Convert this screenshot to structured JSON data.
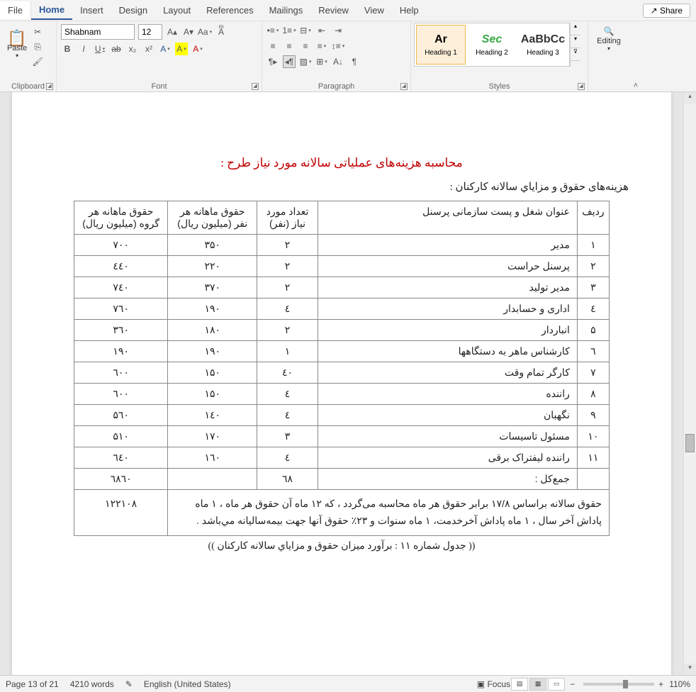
{
  "menus": {
    "file": "File",
    "home": "Home",
    "insert": "Insert",
    "design": "Design",
    "layout": "Layout",
    "references": "References",
    "mailings": "Mailings",
    "review": "Review",
    "view": "View",
    "help": "Help",
    "share": "↗ Share"
  },
  "ribbon": {
    "clipboard": {
      "paste": "Paste",
      "label": "Clipboard"
    },
    "font": {
      "name": "Shabnam",
      "size": "12",
      "label": "Font"
    },
    "paragraph": {
      "label": "Paragraph"
    },
    "styles": {
      "label": "Styles",
      "items": [
        {
          "preview": "Ar",
          "name": "Heading 1"
        },
        {
          "preview": "Sec",
          "name": "Heading 2"
        },
        {
          "preview": "AaBbCc",
          "name": "Heading 3"
        }
      ]
    },
    "editing": {
      "label": "Editing"
    }
  },
  "doc": {
    "title": "محاسبه هزینه‌های عملیاتی سالانه مورد نیاز طرح :",
    "subtitle": "هزینه‌های حقوق و مزاياي سالانه کارکنان :",
    "headers": {
      "row": "ردیف",
      "pos": "عنوان شغل و پست سازمانی پرسنل",
      "count": "تعداد مورد نیاز (نفر)",
      "per": "حقوق ماهانه هر نفر (میلیون ریال)",
      "group": "حقوق ماهانه هر گروه (میلیون ریال)"
    },
    "rows": [
      {
        "n": "۱",
        "t": "مدیر",
        "c": "۲",
        "p": "۳۵۰",
        "g": "۷۰۰"
      },
      {
        "n": "۲",
        "t": "پرسنل حراست",
        "c": "۲",
        "p": "۲۲۰",
        "g": "٤٤۰"
      },
      {
        "n": "۳",
        "t": "مدیر تولید",
        "c": "۲",
        "p": "۳۷۰",
        "g": "۷٤۰"
      },
      {
        "n": "٤",
        "t": "اداری و حسابدار",
        "c": "٤",
        "p": "۱۹۰",
        "g": "۷٦۰"
      },
      {
        "n": "۵",
        "t": "انباردار",
        "c": "۲",
        "p": "۱۸۰",
        "g": "۳٦۰"
      },
      {
        "n": "٦",
        "t": "کارشناس ماهر به دستگاهها",
        "c": "۱",
        "p": "۱۹۰",
        "g": "۱۹۰"
      },
      {
        "n": "۷",
        "t": "کارگر تمام وقت",
        "c": "٤۰",
        "p": "۱۵۰",
        "g": "٦۰۰"
      },
      {
        "n": "۸",
        "t": "راننده",
        "c": "٤",
        "p": "۱۵۰",
        "g": "٦۰۰"
      },
      {
        "n": "۹",
        "t": "نگهبان",
        "c": "٤",
        "p": "۱٤۰",
        "g": "۵٦۰"
      },
      {
        "n": "۱۰",
        "t": "مسئول تاسیسات",
        "c": "۳",
        "p": "۱۷۰",
        "g": "۵۱۰"
      },
      {
        "n": "۱۱",
        "t": "راننده لیفتراک برقی",
        "c": "٤",
        "p": "۱٦۰",
        "g": "٦٤۰"
      }
    ],
    "total": {
      "label": "جمع‌کل :",
      "count": "٦۸",
      "group": "٦۸٦۰"
    },
    "note": "حقوق سالانه براساس ۱۷/۸ برابر حقوق هر ماه محاسبه  می‌گردد ، که ۱۲ ماه آن حقوق هر ماه ، ۱ ماه پاداش آخر سال ، ۱ ماه پاداش آخرخدمت، ۱ ماه سنوات و ۲۳٪ حقوق آنها جهت بیمه‌سالیانه مي‌باشد .",
    "note_total": "۱۲۲۱۰۸",
    "caption": "(( جدول شماره ۱۱ : برآورد میزان حقوق و مزاياي سالانه کارکنان ))"
  },
  "status": {
    "page": "Page 13 of 21",
    "words": "4210 words",
    "lang": "English (United States)",
    "focus": "Focus",
    "zoom": "110%"
  }
}
